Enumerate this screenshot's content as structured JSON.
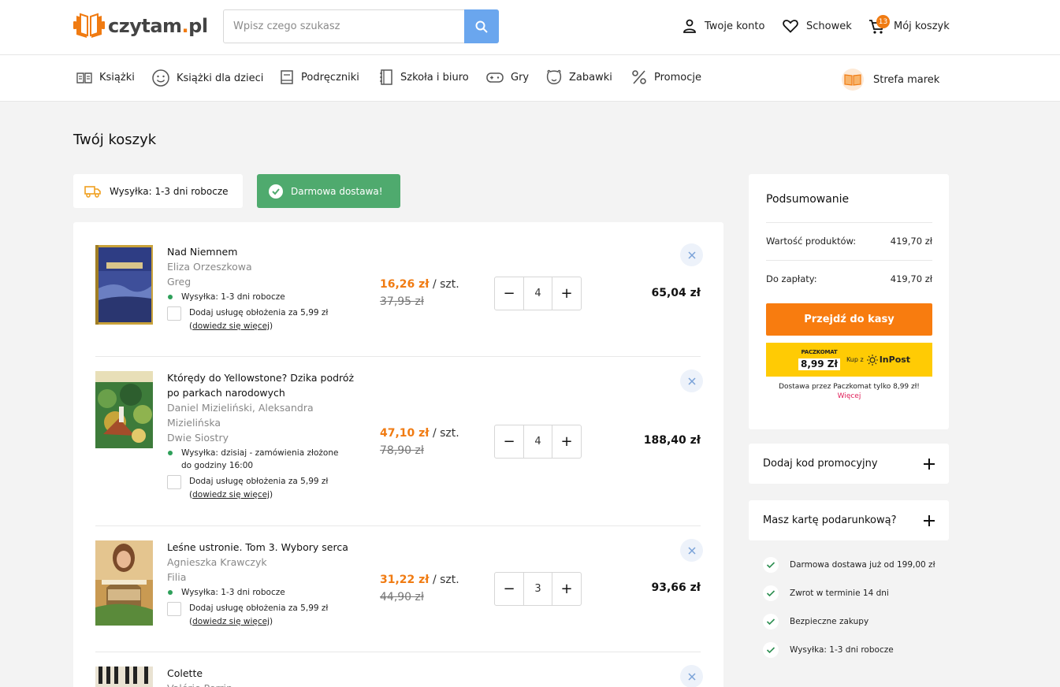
{
  "header": {
    "logo": "czytam.pl",
    "search": {
      "placeholder": "Wpisz czego szukasz",
      "value": ""
    },
    "account": "Twoje konto",
    "wishlist": "Schowek",
    "cart": "Mój koszyk",
    "cart_count": "13"
  },
  "nav": {
    "items": [
      "Książki",
      "Książki dla dzieci",
      "Podręczniki",
      "Szkoła i biuro",
      "Gry",
      "Zabawki",
      "Promocje"
    ],
    "brands": "Strefa marek"
  },
  "page_title": "Twój koszyk",
  "shipping_badge": "Wysyłka: 1-3 dni robocze",
  "free_delivery_badge": "Darmowa dostawa!",
  "cart_items": [
    {
      "title": "Nad Niemnem",
      "author": "Eliza Orzeszkowa",
      "publisher": "Greg",
      "availability": "Wysyłka: 1-3 dni robocze",
      "wrap_text": "Dodaj usługę obłożenia za 5,99 zł",
      "wrap_link": "dowiedz się więcej",
      "price": "16,26 zł",
      "unit": " / szt.",
      "old_price": "37,95 zł",
      "qty": "4",
      "total": "65,04 zł"
    },
    {
      "title": "Którędy do Yellowstone? Dzika podróż po parkach narodowych",
      "author": "Daniel Mizieliński, Aleksandra Mizielińska",
      "publisher": "Dwie Siostry",
      "availability": "Wysyłka: dzisiaj - zamówienia złożone do godziny 16:00",
      "wrap_text": "Dodaj usługę obłożenia za 5,99 zł",
      "wrap_link": "dowiedz się więcej",
      "price": "47,10 zł",
      "unit": " / szt.",
      "old_price": "78,90 zł",
      "qty": "4",
      "total": "188,40 zł"
    },
    {
      "title": "Leśne ustronie. Tom 3. Wybory serca",
      "author": "Agnieszka Krawczyk",
      "publisher": "Filia",
      "availability": "Wysyłka: 1-3 dni robocze",
      "wrap_text": "Dodaj usługę obłożenia za 5,99 zł",
      "wrap_link": "dowiedz się więcej",
      "price": "31,22 zł",
      "unit": " / szt.",
      "old_price": "44,90 zł",
      "qty": "3",
      "total": "93,66 zł"
    },
    {
      "title": "Colette",
      "author": "Valérie Perrin"
    }
  ],
  "summary": {
    "heading": "Podsumowanie",
    "products_label": "Wartość produktów:",
    "products_value": "419,70 zł",
    "to_pay_label": "Do zapłaty:",
    "to_pay_value": "419,70 zł",
    "checkout_button": "Przejdź do kasy",
    "paczkomat_label": "PACZKOMAT",
    "paczkomat_price": "8,99 Zł",
    "kup_z": "Kup z",
    "inpost": "InPost",
    "paczkomat_note": "Dostawa przez Paczkomat tylko 8,99 zł!",
    "more_link": "Więcej"
  },
  "promo_code": "Dodaj kod promocyjny",
  "gift_card": "Masz kartę podarunkową?",
  "perks": [
    "Darmowa dostawa już od 199,00 zł",
    "Zwrot w terminie 14 dni",
    "Bezpieczne zakupy",
    "Wysyłka: 1-3 dni robocze"
  ],
  "colors": {
    "accent": "#f87c0f",
    "green": "#4faa6e",
    "search": "#6aa6ee",
    "inpost": "#ffcb04"
  }
}
